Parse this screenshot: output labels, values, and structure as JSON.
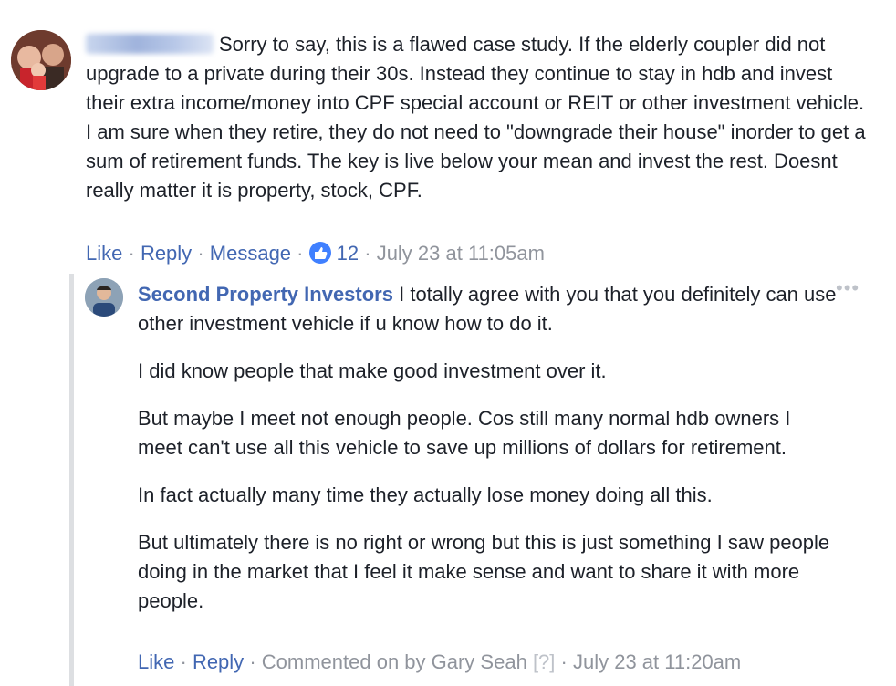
{
  "comment1": {
    "text": "Sorry to say, this is a flawed case study. If the elderly coupler did not upgrade to a private during their 30s. Instead they continue to stay in hdb and invest their extra income/money into CPF special account or REIT or other investment vehicle. I am sure when they retire, they do not need to \"downgrade their house\" inorder to get a sum of retirement funds. The key is live below your mean and invest the rest. Doesnt really matter it is property, stock, CPF.",
    "actions": {
      "like": "Like",
      "reply": "Reply",
      "message": "Message",
      "like_count": "12",
      "timestamp": "July 23 at 11:05am"
    }
  },
  "comment2": {
    "author": "Second Property Investors",
    "first_paragraph": "I totally agree with you that you definitely can use other investment vehicle if u know how to do it.",
    "paragraphs": [
      "I did know people that make good investment over it.",
      "But maybe I meet not enough people. Cos still many normal hdb owners I meet can't use all this vehicle to save up millions of dollars for retirement.",
      "In fact actually many time they actually lose money doing all this.",
      "But ultimately there is no right or wrong but this is just something I saw people doing in the market that I feel it make sense and want to share it with more people."
    ],
    "actions": {
      "like": "Like",
      "reply": "Reply",
      "commented_by": "Commented on by Gary Seah",
      "help_marker": "[?]",
      "timestamp": "July 23 at 11:20am"
    }
  },
  "colors": {
    "link": "#4267b2",
    "meta": "#90949c",
    "like_badge": "#4080ff"
  },
  "icons": {
    "more": "more-options-icon",
    "like": "like-thumb-icon"
  }
}
